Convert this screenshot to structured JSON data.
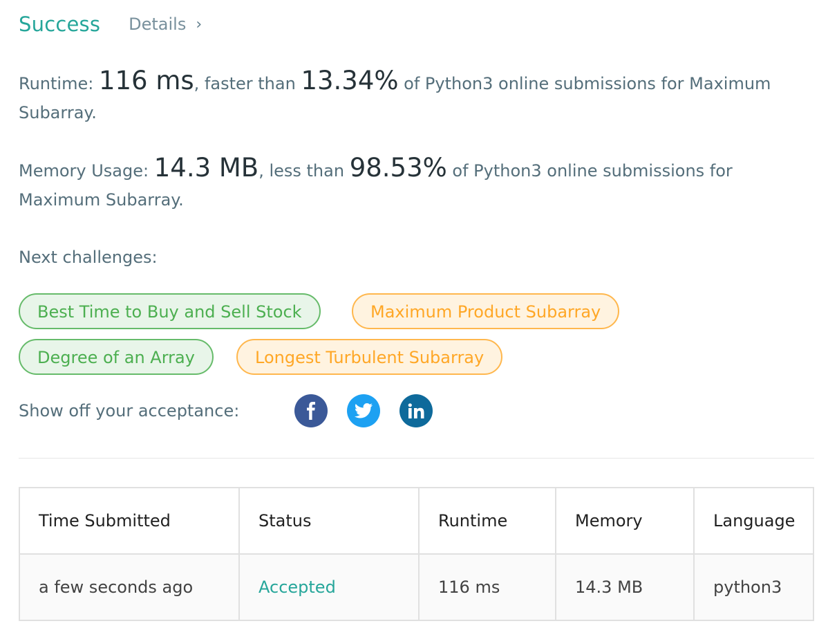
{
  "header": {
    "status": "Success",
    "details_label": "Details",
    "chevron": "›"
  },
  "runtime": {
    "label": "Runtime: ",
    "value": "116 ms",
    "mid": ", faster than ",
    "percent": "13.34%",
    "tail": " of Python3 online submissions for Maximum Subarray."
  },
  "memory": {
    "label": "Memory Usage: ",
    "value": "14.3 MB",
    "mid": ", less than ",
    "percent": "98.53%",
    "tail": " of Python3 online submissions for Maximum Subarray."
  },
  "next": {
    "label": "Next challenges:",
    "tags": [
      {
        "label": "Best Time to Buy and Sell Stock",
        "difficulty": "easy",
        "color": "#66bb6a"
      },
      {
        "label": "Maximum Product Subarray",
        "difficulty": "medium",
        "color": "#ffb74d"
      },
      {
        "label": "Degree of an Array",
        "difficulty": "easy",
        "color": "#66bb6a"
      },
      {
        "label": "Longest Turbulent Subarray",
        "difficulty": "medium",
        "color": "#ffb74d"
      }
    ]
  },
  "share": {
    "label": "Show off your acceptance:",
    "icons": [
      {
        "name": "facebook-icon",
        "color": "#3b5998"
      },
      {
        "name": "twitter-icon",
        "color": "#1da1f2"
      },
      {
        "name": "linkedin-icon",
        "color": "#0e6a9b"
      }
    ]
  },
  "table": {
    "headers": [
      "Time Submitted",
      "Status",
      "Runtime",
      "Memory",
      "Language"
    ],
    "rows": [
      [
        "a few seconds ago",
        "Accepted",
        "116 ms",
        "14.3 MB",
        "python3"
      ]
    ]
  },
  "colors": {
    "success": "#26a69a",
    "easy": "#66bb6a",
    "medium": "#ffb74d"
  }
}
